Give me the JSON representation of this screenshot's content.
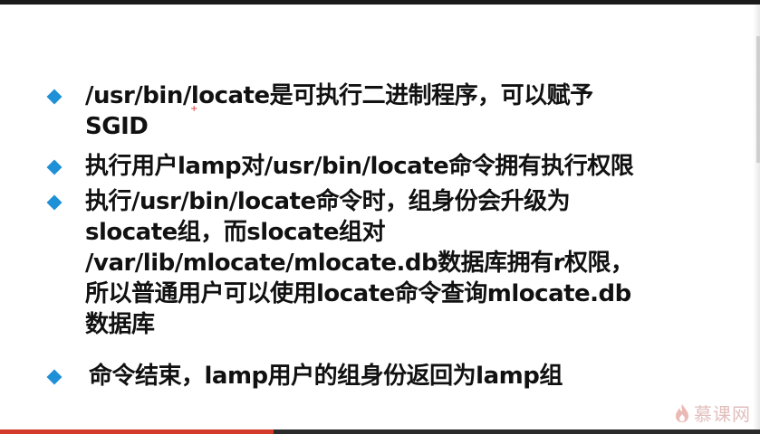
{
  "slide": {
    "bullets": [
      "/usr/bin/locate是可执行二进制程序，可以赋予\nSGID",
      "执行用户lamp对/usr/bin/locate命令拥有执行权限",
      "执行/usr/bin/locate命令时，组身份会升级为\nslocate组，而slocate组对\n/var/lib/mlocate/mlocate.db数据库拥有r权限，\n所以普通用户可以使用locate命令查询mlocate.db\n数据库",
      "命令结束，lamp用户的组身份返回为lamp组"
    ],
    "bullet_icon": "diamond-icon",
    "bullet_color": "#1e90d8",
    "annotation_mark": "+"
  },
  "player": {
    "progress_fraction": 0.36,
    "progress_color": "#d43a2a"
  },
  "watermark": {
    "text": "慕课网",
    "icon": "flame-logo-icon"
  }
}
